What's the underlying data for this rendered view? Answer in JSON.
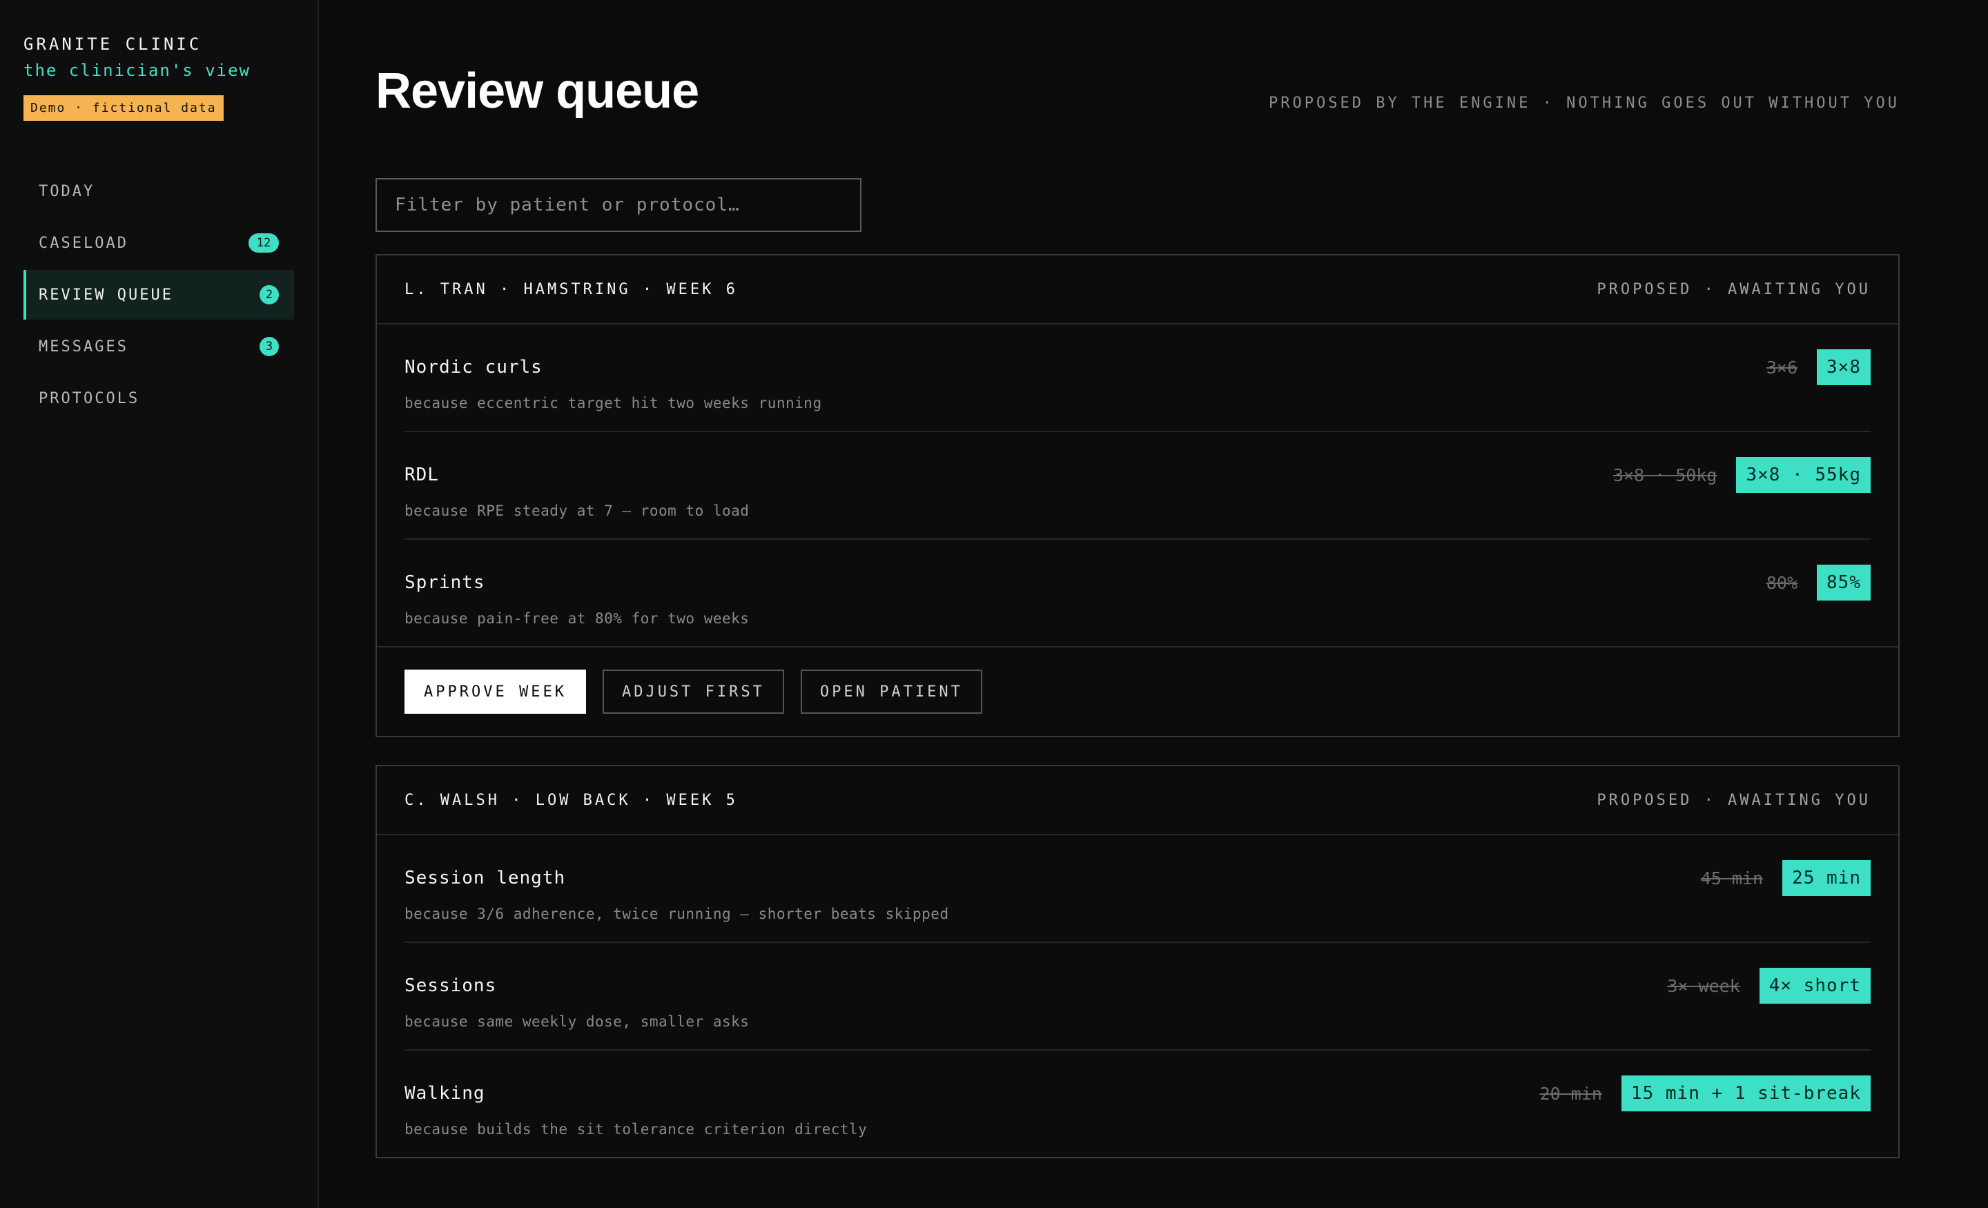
{
  "brand": {
    "name": "GRANITE CLINIC",
    "subtitle": "the clinician's view",
    "demo_badge": "Demo · fictional data"
  },
  "nav": {
    "items": [
      {
        "label": "TODAY",
        "badge": null,
        "active": false
      },
      {
        "label": "CASELOAD",
        "badge": "12",
        "active": false
      },
      {
        "label": "REVIEW QUEUE",
        "badge": "2",
        "active": true
      },
      {
        "label": "MESSAGES",
        "badge": "3",
        "active": false
      },
      {
        "label": "PROTOCOLS",
        "badge": null,
        "active": false
      }
    ]
  },
  "header": {
    "title": "Review queue",
    "note": "PROPOSED BY THE ENGINE · NOTHING GOES OUT WITHOUT YOU"
  },
  "filter": {
    "placeholder": "Filter by patient or protocol…",
    "value": ""
  },
  "cards": [
    {
      "title": "L. TRAN · HAMSTRING · WEEK 6",
      "status": "PROPOSED · AWAITING YOU",
      "changes": [
        {
          "name": "Nordic curls",
          "old": "3×6",
          "new": "3×8",
          "reason": "because eccentric target hit two weeks running"
        },
        {
          "name": "RDL",
          "old": "3×8 · 50kg",
          "new": "3×8 · 55kg",
          "reason": "because RPE steady at 7 — room to load"
        },
        {
          "name": "Sprints",
          "old": "80%",
          "new": "85%",
          "reason": "because pain-free at 80% for two weeks"
        }
      ],
      "actions": {
        "approve": "APPROVE WEEK",
        "adjust": "ADJUST FIRST",
        "open": "OPEN PATIENT"
      }
    },
    {
      "title": "C. WALSH · LOW BACK · WEEK 5",
      "status": "PROPOSED · AWAITING YOU",
      "changes": [
        {
          "name": "Session length",
          "old": "45 min",
          "new": "25 min",
          "reason": "because 3/6 adherence, twice running — shorter beats skipped"
        },
        {
          "name": "Sessions",
          "old": "3× week",
          "new": "4× short",
          "reason": "because same weekly dose, smaller asks"
        },
        {
          "name": "Walking",
          "old": "20 min",
          "new": "15 min + 1 sit-break",
          "reason": "because builds the sit tolerance criterion directly"
        }
      ]
    }
  ],
  "colors": {
    "accent": "#3ee0c5",
    "demo_badge": "#f6b352",
    "background": "#0b0b0b"
  }
}
